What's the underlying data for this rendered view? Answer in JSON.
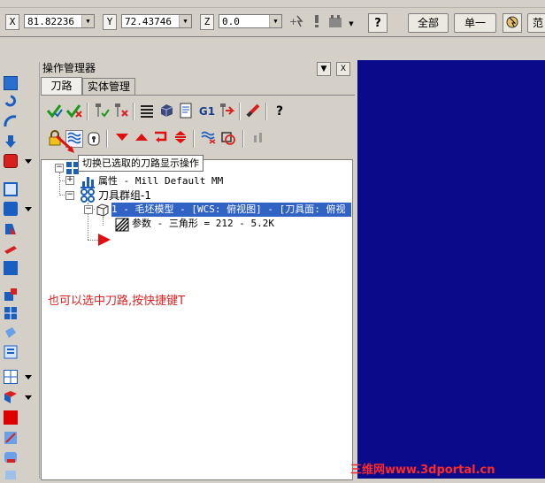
{
  "coordinates": {
    "x_label": "X",
    "x_value": "81.82236",
    "y_label": "Y",
    "y_value": "72.43746",
    "z_label": "Z",
    "z_value": "0.0"
  },
  "toolbar": {
    "all_button": "全部",
    "single_button": "单一",
    "range_button": "范"
  },
  "panel": {
    "title": "操作管理器",
    "dropdown_glyph": "▼",
    "close_glyph": "X",
    "tabs": [
      "刀路",
      "实体管理"
    ]
  },
  "tooltip": "切换已选取的刀路显示操作",
  "tree": {
    "properties": "属性 - Mill Default MM",
    "tool_group": "刀具群组-1",
    "operation": "1 - 毛坯模型 - [WCS: 俯视图] - [刀具面: 俯视",
    "parameters": "参数 - 三角形 =  212 - 5.2K"
  },
  "annotation": "也可以选中刀路,按快捷键T",
  "watermark": "三维网www.3dportal.cn",
  "colors": {
    "viewport_bg": "#0a0a8a",
    "selection_bg": "#3163c5",
    "annotation": "#e02020",
    "arrow_red": "#e01010"
  }
}
